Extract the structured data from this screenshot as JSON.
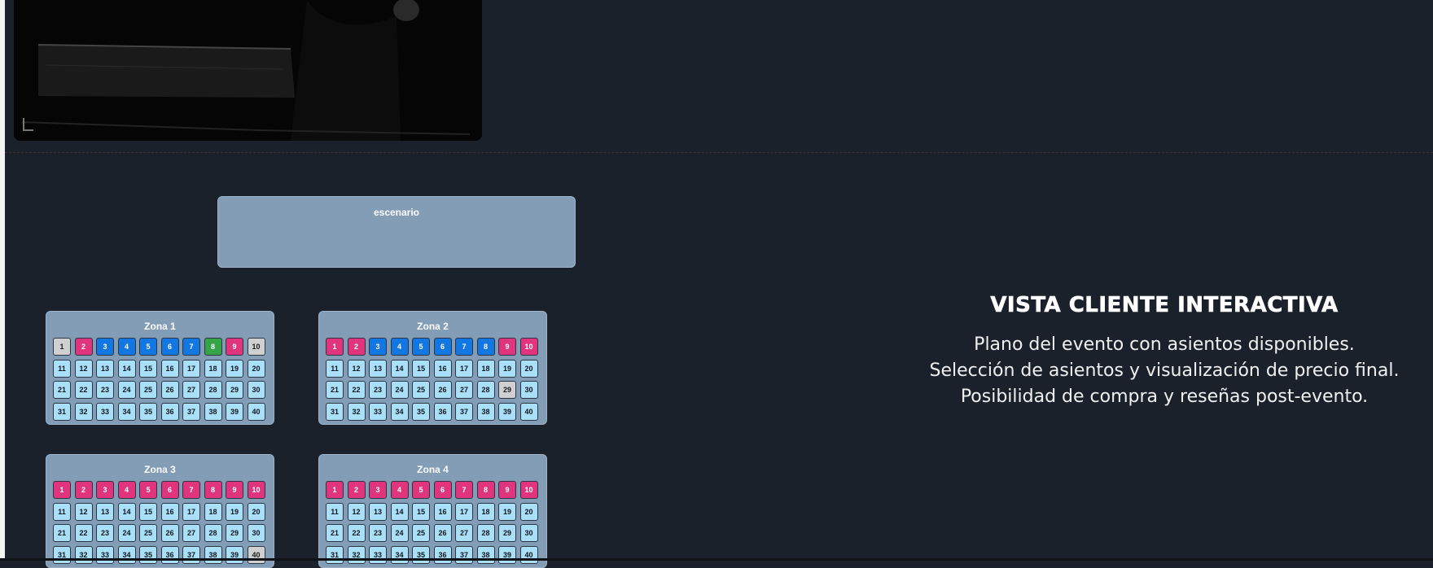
{
  "video": {
    "content": "dark concert footage"
  },
  "stage": {
    "label": "escenario"
  },
  "seat_colors": {
    "available": "#a9dff7",
    "booked": "#e0347c",
    "reserved": "#1277e1",
    "blocked": "#d0d0d0",
    "selected": "#34a447"
  },
  "zones": [
    {
      "title": "Zona 1",
      "seats": [
        {
          "n": "1",
          "s": "blocked"
        },
        {
          "n": "2",
          "s": "booked"
        },
        {
          "n": "3",
          "s": "reserved"
        },
        {
          "n": "4",
          "s": "reserved"
        },
        {
          "n": "5",
          "s": "reserved"
        },
        {
          "n": "6",
          "s": "reserved"
        },
        {
          "n": "7",
          "s": "reserved"
        },
        {
          "n": "8",
          "s": "selected"
        },
        {
          "n": "9",
          "s": "booked"
        },
        {
          "n": "10",
          "s": "blocked"
        },
        {
          "n": "11",
          "s": "available"
        },
        {
          "n": "12",
          "s": "available"
        },
        {
          "n": "13",
          "s": "available"
        },
        {
          "n": "14",
          "s": "available"
        },
        {
          "n": "15",
          "s": "available"
        },
        {
          "n": "16",
          "s": "available"
        },
        {
          "n": "17",
          "s": "available"
        },
        {
          "n": "18",
          "s": "available"
        },
        {
          "n": "19",
          "s": "available"
        },
        {
          "n": "20",
          "s": "available"
        },
        {
          "n": "21",
          "s": "available"
        },
        {
          "n": "22",
          "s": "available"
        },
        {
          "n": "23",
          "s": "available"
        },
        {
          "n": "24",
          "s": "available"
        },
        {
          "n": "25",
          "s": "available"
        },
        {
          "n": "26",
          "s": "available"
        },
        {
          "n": "27",
          "s": "available"
        },
        {
          "n": "28",
          "s": "available"
        },
        {
          "n": "29",
          "s": "available"
        },
        {
          "n": "30",
          "s": "available"
        },
        {
          "n": "31",
          "s": "available"
        },
        {
          "n": "32",
          "s": "available"
        },
        {
          "n": "33",
          "s": "available"
        },
        {
          "n": "34",
          "s": "available"
        },
        {
          "n": "35",
          "s": "available"
        },
        {
          "n": "36",
          "s": "available"
        },
        {
          "n": "37",
          "s": "available"
        },
        {
          "n": "38",
          "s": "available"
        },
        {
          "n": "39",
          "s": "available"
        },
        {
          "n": "40",
          "s": "available"
        }
      ]
    },
    {
      "title": "Zona 2",
      "seats": [
        {
          "n": "1",
          "s": "booked"
        },
        {
          "n": "2",
          "s": "booked"
        },
        {
          "n": "3",
          "s": "reserved"
        },
        {
          "n": "4",
          "s": "reserved"
        },
        {
          "n": "5",
          "s": "reserved"
        },
        {
          "n": "6",
          "s": "reserved"
        },
        {
          "n": "7",
          "s": "reserved"
        },
        {
          "n": "8",
          "s": "reserved"
        },
        {
          "n": "9",
          "s": "booked"
        },
        {
          "n": "10",
          "s": "booked"
        },
        {
          "n": "11",
          "s": "available"
        },
        {
          "n": "12",
          "s": "available"
        },
        {
          "n": "13",
          "s": "available"
        },
        {
          "n": "14",
          "s": "available"
        },
        {
          "n": "15",
          "s": "available"
        },
        {
          "n": "16",
          "s": "available"
        },
        {
          "n": "17",
          "s": "available"
        },
        {
          "n": "18",
          "s": "available"
        },
        {
          "n": "19",
          "s": "available"
        },
        {
          "n": "20",
          "s": "available"
        },
        {
          "n": "21",
          "s": "available"
        },
        {
          "n": "22",
          "s": "available"
        },
        {
          "n": "23",
          "s": "available"
        },
        {
          "n": "24",
          "s": "available"
        },
        {
          "n": "25",
          "s": "available"
        },
        {
          "n": "26",
          "s": "available"
        },
        {
          "n": "27",
          "s": "available"
        },
        {
          "n": "28",
          "s": "available"
        },
        {
          "n": "29",
          "s": "blocked"
        },
        {
          "n": "30",
          "s": "available"
        },
        {
          "n": "31",
          "s": "available"
        },
        {
          "n": "32",
          "s": "available"
        },
        {
          "n": "33",
          "s": "available"
        },
        {
          "n": "34",
          "s": "available"
        },
        {
          "n": "35",
          "s": "available"
        },
        {
          "n": "36",
          "s": "available"
        },
        {
          "n": "37",
          "s": "available"
        },
        {
          "n": "38",
          "s": "available"
        },
        {
          "n": "39",
          "s": "available"
        },
        {
          "n": "40",
          "s": "available"
        }
      ]
    },
    {
      "title": "Zona 3",
      "seats": [
        {
          "n": "1",
          "s": "booked"
        },
        {
          "n": "2",
          "s": "booked"
        },
        {
          "n": "3",
          "s": "booked"
        },
        {
          "n": "4",
          "s": "booked"
        },
        {
          "n": "5",
          "s": "booked"
        },
        {
          "n": "6",
          "s": "booked"
        },
        {
          "n": "7",
          "s": "booked"
        },
        {
          "n": "8",
          "s": "booked"
        },
        {
          "n": "9",
          "s": "booked"
        },
        {
          "n": "10",
          "s": "booked"
        },
        {
          "n": "11",
          "s": "available"
        },
        {
          "n": "12",
          "s": "available"
        },
        {
          "n": "13",
          "s": "available"
        },
        {
          "n": "14",
          "s": "available"
        },
        {
          "n": "15",
          "s": "available"
        },
        {
          "n": "16",
          "s": "available"
        },
        {
          "n": "17",
          "s": "available"
        },
        {
          "n": "18",
          "s": "available"
        },
        {
          "n": "19",
          "s": "available"
        },
        {
          "n": "20",
          "s": "available"
        },
        {
          "n": "21",
          "s": "available"
        },
        {
          "n": "22",
          "s": "available"
        },
        {
          "n": "23",
          "s": "available"
        },
        {
          "n": "24",
          "s": "available"
        },
        {
          "n": "25",
          "s": "available"
        },
        {
          "n": "26",
          "s": "available"
        },
        {
          "n": "27",
          "s": "available"
        },
        {
          "n": "28",
          "s": "available"
        },
        {
          "n": "29",
          "s": "available"
        },
        {
          "n": "30",
          "s": "available"
        },
        {
          "n": "31",
          "s": "available"
        },
        {
          "n": "32",
          "s": "available"
        },
        {
          "n": "33",
          "s": "available"
        },
        {
          "n": "34",
          "s": "available"
        },
        {
          "n": "35",
          "s": "available"
        },
        {
          "n": "36",
          "s": "available"
        },
        {
          "n": "37",
          "s": "available"
        },
        {
          "n": "38",
          "s": "available"
        },
        {
          "n": "39",
          "s": "available"
        },
        {
          "n": "40",
          "s": "blocked"
        }
      ]
    },
    {
      "title": "Zona 4",
      "seats": [
        {
          "n": "1",
          "s": "booked"
        },
        {
          "n": "2",
          "s": "booked"
        },
        {
          "n": "3",
          "s": "booked"
        },
        {
          "n": "4",
          "s": "booked"
        },
        {
          "n": "5",
          "s": "booked"
        },
        {
          "n": "6",
          "s": "booked"
        },
        {
          "n": "7",
          "s": "booked"
        },
        {
          "n": "8",
          "s": "booked"
        },
        {
          "n": "9",
          "s": "booked"
        },
        {
          "n": "10",
          "s": "booked"
        },
        {
          "n": "11",
          "s": "available"
        },
        {
          "n": "12",
          "s": "available"
        },
        {
          "n": "13",
          "s": "available"
        },
        {
          "n": "14",
          "s": "available"
        },
        {
          "n": "15",
          "s": "available"
        },
        {
          "n": "16",
          "s": "available"
        },
        {
          "n": "17",
          "s": "available"
        },
        {
          "n": "18",
          "s": "available"
        },
        {
          "n": "19",
          "s": "available"
        },
        {
          "n": "20",
          "s": "available"
        },
        {
          "n": "21",
          "s": "available"
        },
        {
          "n": "22",
          "s": "available"
        },
        {
          "n": "23",
          "s": "available"
        },
        {
          "n": "24",
          "s": "available"
        },
        {
          "n": "25",
          "s": "available"
        },
        {
          "n": "26",
          "s": "available"
        },
        {
          "n": "27",
          "s": "available"
        },
        {
          "n": "28",
          "s": "available"
        },
        {
          "n": "29",
          "s": "available"
        },
        {
          "n": "30",
          "s": "available"
        },
        {
          "n": "31",
          "s": "available"
        },
        {
          "n": "32",
          "s": "available"
        },
        {
          "n": "33",
          "s": "available"
        },
        {
          "n": "34",
          "s": "available"
        },
        {
          "n": "35",
          "s": "available"
        },
        {
          "n": "36",
          "s": "available"
        },
        {
          "n": "37",
          "s": "available"
        },
        {
          "n": "38",
          "s": "available"
        },
        {
          "n": "39",
          "s": "available"
        },
        {
          "n": "40",
          "s": "available"
        }
      ]
    }
  ],
  "promo": {
    "title": "VISTA CLIENTE INTERACTIVA",
    "lines": [
      "Plano del evento con asientos disponibles.",
      "Selección de asientos y visualización de precio final.",
      "Posibilidad de compra y reseñas post-evento."
    ]
  }
}
